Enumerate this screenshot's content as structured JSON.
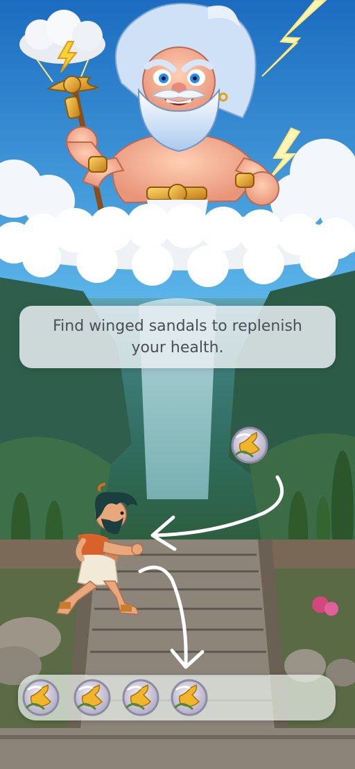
{
  "hint": {
    "text": "Find winged sandals to replenish your health."
  },
  "tray": {
    "sandal_count": 4
  },
  "colors": {
    "hint_bg": "#e6eef0",
    "hint_text": "#4a4f55",
    "arrow": "#ffffff",
    "token_rim": "#8d8aa3",
    "sandal": "#f0b52a"
  }
}
